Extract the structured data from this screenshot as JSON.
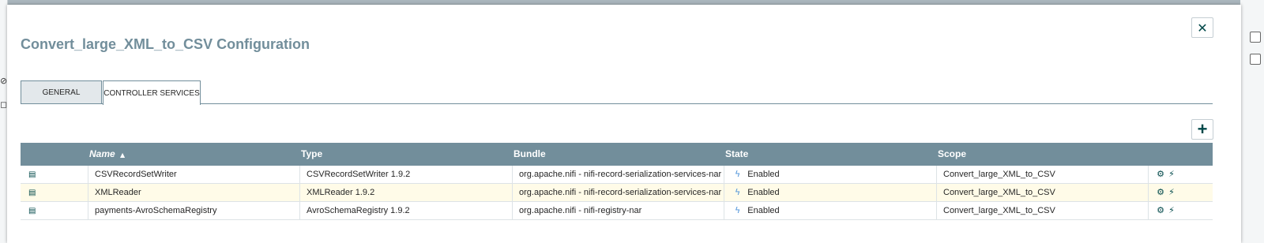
{
  "dialog": {
    "title": "Convert_large_XML_to_CSV Configuration",
    "close_icon": "close-icon",
    "tabs": [
      {
        "label": "GENERAL"
      },
      {
        "label": "CONTROLLER SERVICES"
      }
    ],
    "add_icon": "plus-icon"
  },
  "table": {
    "columns": [
      "",
      "Name",
      "Type",
      "Bundle",
      "State",
      "Scope",
      ""
    ],
    "sort_indicator": "▲",
    "rows": [
      {
        "name": "CSVRecordSetWriter",
        "type": "CSVRecordSetWriter 1.9.2",
        "bundle": "org.apache.nifi - nifi-record-serialization-services-nar",
        "state": "Enabled",
        "scope": "Convert_large_XML_to_CSV"
      },
      {
        "name": "XMLReader",
        "type": "XMLReader 1.9.2",
        "bundle": "org.apache.nifi - nifi-record-serialization-services-nar",
        "state": "Enabled",
        "scope": "Convert_large_XML_to_CSV"
      },
      {
        "name": "payments-AvroSchemaRegistry",
        "type": "AvroSchemaRegistry 1.9.2",
        "bundle": "org.apache.nifi - nifi-registry-nar",
        "state": "Enabled",
        "scope": "Convert_large_XML_to_CSV"
      }
    ]
  },
  "colors": {
    "header_bg": "#728e9b",
    "title": "#728e9b",
    "accent": "#004849",
    "selected_row": "#fffbe8",
    "bolt": "#4a90d9"
  }
}
